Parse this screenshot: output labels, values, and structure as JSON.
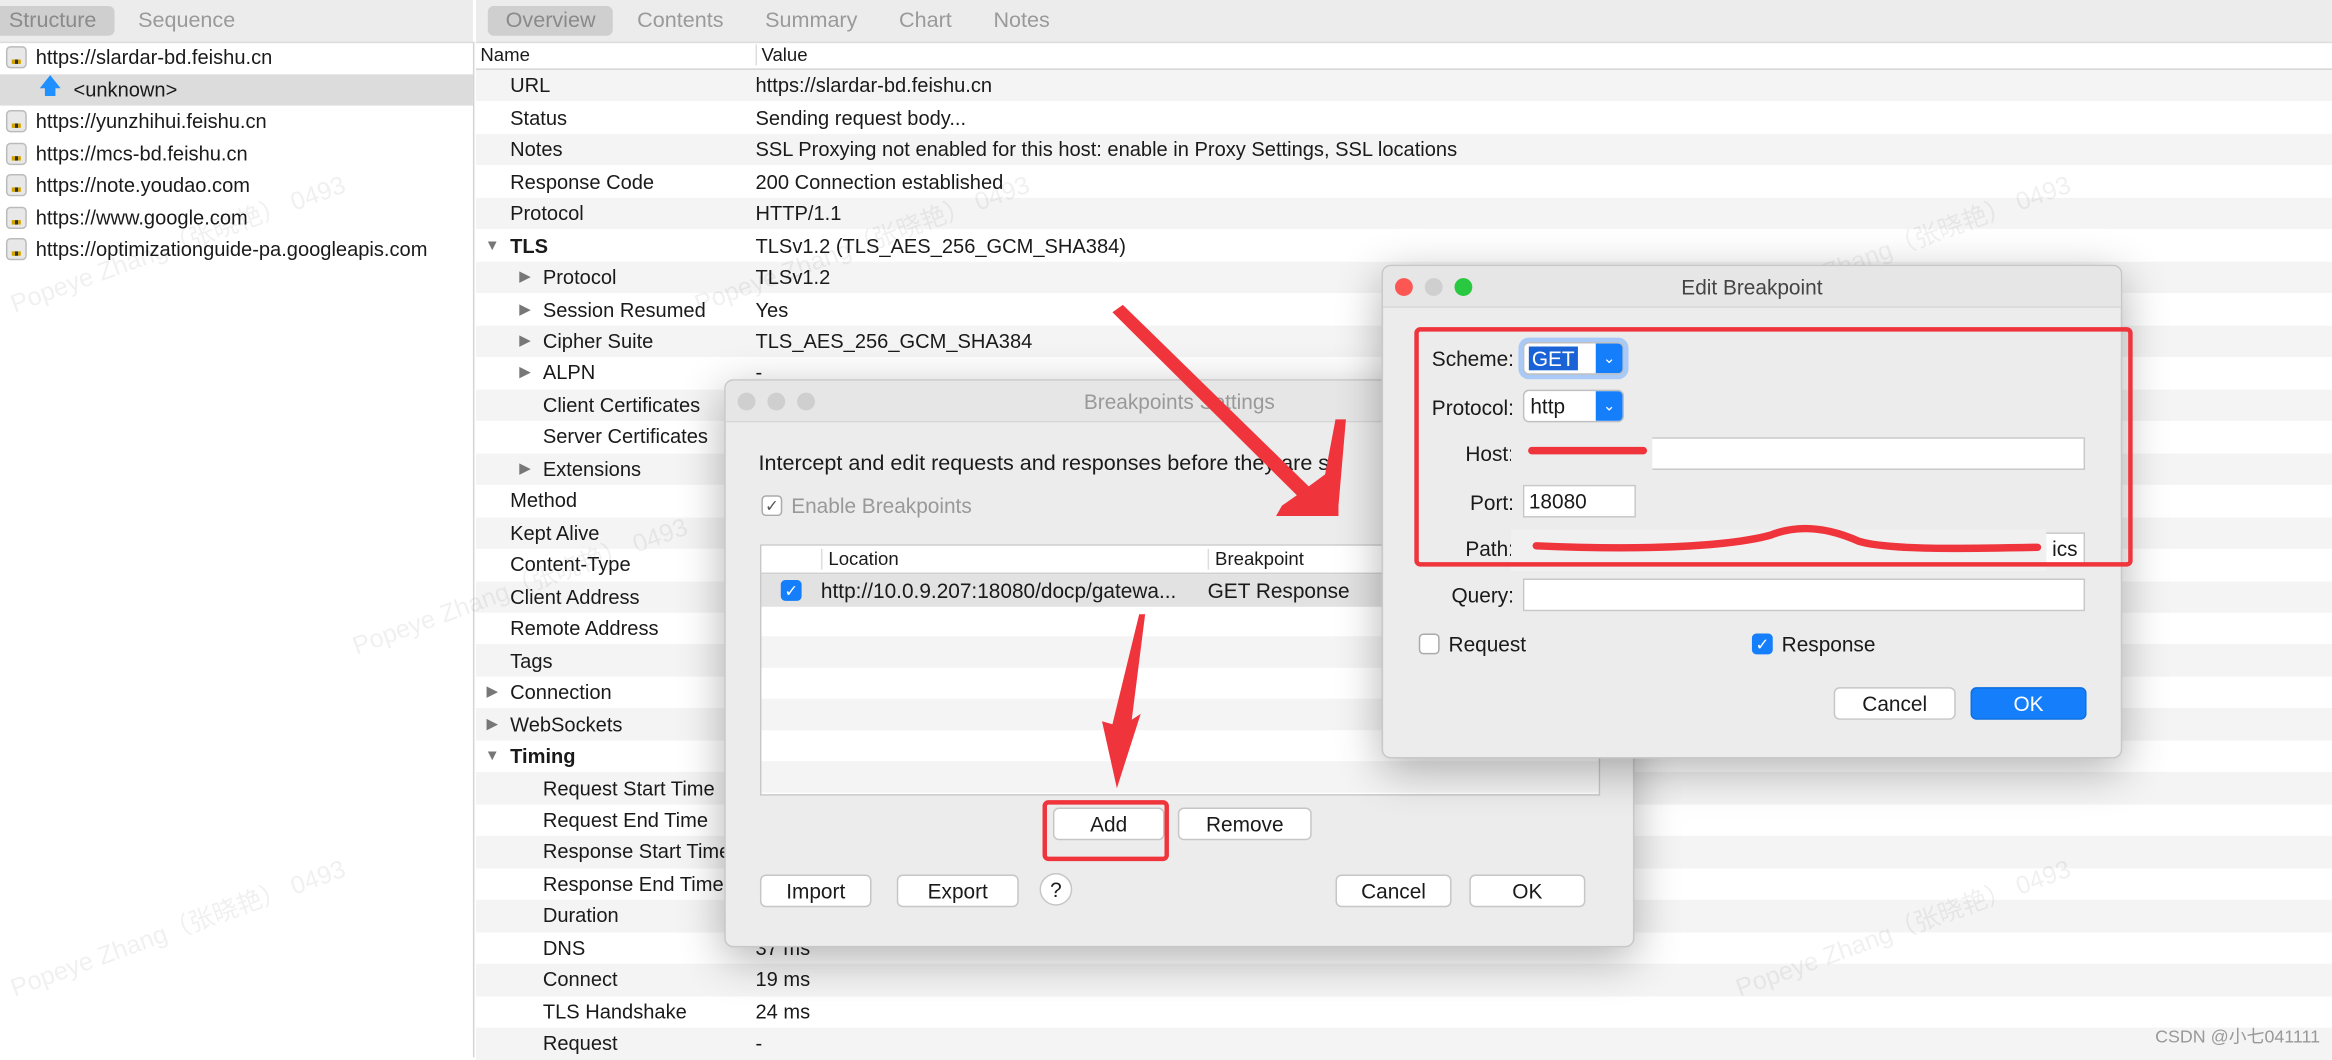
{
  "left_tabs": [
    "Structure",
    "Sequence"
  ],
  "right_tabs": [
    "Overview",
    "Contents",
    "Summary",
    "Chart",
    "Notes"
  ],
  "hosts": [
    {
      "label": "https://slardar-bd.feishu.cn",
      "icon": "lock-icon"
    },
    {
      "label": "<unknown>",
      "icon": "upload-arrow-icon",
      "selected": true
    },
    {
      "label": "https://yunzhihui.feishu.cn",
      "icon": "lock-icon"
    },
    {
      "label": "https://mcs-bd.feishu.cn",
      "icon": "lightning-lock-icon"
    },
    {
      "label": "https://note.youdao.com",
      "icon": "lock-icon"
    },
    {
      "label": "https://www.google.com",
      "icon": "lock-icon"
    },
    {
      "label": "https://optimizationguide-pa.googleapis.com",
      "icon": "lock-icon"
    }
  ],
  "overview": {
    "headers": [
      "Name",
      "Value"
    ],
    "rows": [
      {
        "name": "URL",
        "value": "https://slardar-bd.feishu.cn",
        "lvl": 0
      },
      {
        "name": "Status",
        "value": "Sending request body...",
        "lvl": 0
      },
      {
        "name": "Notes",
        "value": "SSL Proxying not enabled for this host: enable in Proxy Settings, SSL locations",
        "lvl": 0
      },
      {
        "name": "Response Code",
        "value": "200 Connection established",
        "lvl": 0
      },
      {
        "name": "Protocol",
        "value": "HTTP/1.1",
        "lvl": 0
      },
      {
        "name": "TLS",
        "value": "TLSv1.2 (TLS_AES_256_GCM_SHA384)",
        "lvl": 0,
        "tri": "open",
        "bold": true
      },
      {
        "name": "Protocol",
        "value": "TLSv1.2",
        "lvl": 1,
        "tri": "closed"
      },
      {
        "name": "Session Resumed",
        "value": "Yes",
        "lvl": 1,
        "tri": "closed"
      },
      {
        "name": "Cipher Suite",
        "value": "TLS_AES_256_GCM_SHA384",
        "lvl": 1,
        "tri": "closed"
      },
      {
        "name": "ALPN",
        "value": "-",
        "lvl": 1,
        "tri": "closed"
      },
      {
        "name": "Client Certificates",
        "value": "",
        "lvl": 1
      },
      {
        "name": "Server Certificates",
        "value": "",
        "lvl": 1
      },
      {
        "name": "Extensions",
        "value": "",
        "lvl": 1,
        "tri": "closed"
      },
      {
        "name": "Method",
        "value": "",
        "lvl": 0
      },
      {
        "name": "Kept Alive",
        "value": "",
        "lvl": 0
      },
      {
        "name": "Content-Type",
        "value": "",
        "lvl": 0
      },
      {
        "name": "Client Address",
        "value": "",
        "lvl": 0
      },
      {
        "name": "Remote Address",
        "value": "",
        "lvl": 0
      },
      {
        "name": "Tags",
        "value": "",
        "lvl": 0
      },
      {
        "name": "Connection",
        "value": "",
        "lvl": 0,
        "tri": "closed"
      },
      {
        "name": "WebSockets",
        "value": "",
        "lvl": 0,
        "tri": "closed"
      },
      {
        "name": "Timing",
        "value": "",
        "lvl": 0,
        "tri": "open",
        "bold": true
      },
      {
        "name": "Request Start Time",
        "value": "",
        "lvl": 1
      },
      {
        "name": "Request End Time",
        "value": "",
        "lvl": 1
      },
      {
        "name": "Response Start Time",
        "value": "",
        "lvl": 1
      },
      {
        "name": "Response End Time",
        "value": "",
        "lvl": 1
      },
      {
        "name": "Duration",
        "value": "",
        "lvl": 1
      },
      {
        "name": "DNS",
        "value": "37 ms",
        "lvl": 1
      },
      {
        "name": "Connect",
        "value": "19 ms",
        "lvl": 1
      },
      {
        "name": "TLS Handshake",
        "value": "24 ms",
        "lvl": 1
      },
      {
        "name": "Request",
        "value": "-",
        "lvl": 1
      }
    ]
  },
  "breakpoints_dialog": {
    "title": "Breakpoints Settings",
    "description": "Intercept and edit requests and responses before they are s",
    "enable_label": "Enable Breakpoints",
    "enable_checked": true,
    "columns": [
      "Location",
      "Breakpoint"
    ],
    "entries": [
      {
        "checked": true,
        "location": "http://10.0.9.207:18080/docp/gatewa...",
        "breakpoint": "GET Response"
      }
    ],
    "add": "Add",
    "remove": "Remove",
    "import": "Import",
    "export": "Export",
    "help": "?",
    "cancel": "Cancel",
    "ok": "OK"
  },
  "edit_dialog": {
    "title": "Edit Breakpoint",
    "scheme_label": "Scheme:",
    "scheme": "GET",
    "protocol_label": "Protocol:",
    "protocol": "http",
    "host_label": "Host:",
    "host": "",
    "port_label": "Port:",
    "port": "18080",
    "path_label": "Path:",
    "path": "ics",
    "query_label": "Query:",
    "query": "",
    "request_label": "Request",
    "request_checked": false,
    "response_label": "Response",
    "response_checked": true,
    "cancel": "Cancel",
    "ok": "OK"
  },
  "watermark": "Popeye Zhang（张晓艳） 0493",
  "credit": "CSDN @小七041111",
  "colors": {
    "accent": "#157efb",
    "annotation": "#f0343c"
  }
}
